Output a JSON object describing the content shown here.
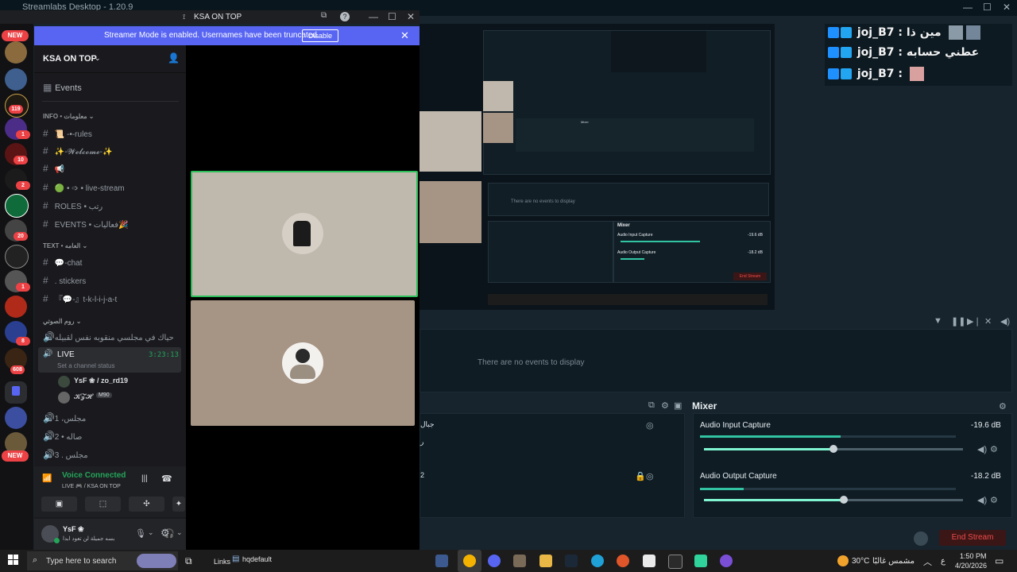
{
  "streamlabs": {
    "window_title": "Streamlabs Desktop - 1.20.9",
    "chat_overlay": [
      {
        "user": "joj_B7",
        "message": "مين ذا"
      },
      {
        "user": "joj_B7",
        "message": "عطني حسابه"
      },
      {
        "user": "joj_B7",
        "message": ""
      }
    ],
    "events_empty": "There are no events to display",
    "mixer_title": "Mixer",
    "mixer": [
      {
        "label": "Audio Input Capture",
        "db": "-19.6 dB",
        "level": 0.55,
        "volume": 0.5
      },
      {
        "label": "Audio Output Capture",
        "db": "-18.2 dB",
        "level": 0.17,
        "volume": 0.54
      }
    ],
    "scene_rows": [
      "جبال",
      "ر",
      "2"
    ],
    "end_stream": "End Stream",
    "preview_labels": {
      "audio_input": "Audio Input Capture",
      "audio_output": "Audio Output Capture",
      "events": "There are no events to display",
      "mixer": "Mixer",
      "db_input": "-19.6 dB",
      "db_output": "-18.2 dB",
      "end_stream": "End Stream"
    }
  },
  "discord": {
    "title": "KSA ON TOP",
    "banner": {
      "text": "Streamer Mode is enabled. Usernames have been truncated.",
      "button": "Disable"
    },
    "server_name": "KSA ON TOP",
    "events_label": "Events",
    "categories": [
      {
        "name": "INFO • معلومات",
        "channels": [
          "📜 -•-rules",
          "✨-𝓦𝓮𝓵𝓬𝓸𝓶𝓮-✨",
          "📢",
          "🟢 • ➩ • live-stream",
          "ROLES • رتب",
          "EVENTS • فعاليات🎉"
        ]
      },
      {
        "name": "TEXT • العامه",
        "channels": [
          "💬-chat",
          ". stickers",
          "『💬-』t-k-l-i-j-a-t"
        ]
      },
      {
        "name": "روم الصوتي",
        "channels": [
          "حياك في مجلسي منقوبه نفس لقبيله"
        ]
      }
    ],
    "live_channel": {
      "name": "LIVE",
      "status": "Set a channel status",
      "timer": "3:23:13"
    },
    "voice_members": [
      {
        "name": "YsF ❀ / zo_rd19"
      },
      {
        "name": "𝓚𝓩𝓗",
        "tag": "M90"
      }
    ],
    "voice_channels": [
      "مجلس، 1",
      "صاله • 2",
      "مجلس . 3"
    ],
    "voice_status": {
      "title": "Voice Connected",
      "detail": "LIVE 🎮 / KSA ON TOP"
    },
    "user": {
      "name": "YsF ❀",
      "status": "بسه جميلة لن تعود ابدا"
    },
    "rail_badges": [
      "119",
      "1",
      "10",
      "2",
      "20",
      "1",
      "8",
      "608",
      "1"
    ],
    "new_label": "NEW"
  },
  "taskbar": {
    "search_placeholder": "Type here to search",
    "links": "Links",
    "folder": "hqdefault",
    "weather": "30°C",
    "weather_text": "مشمس غالبًا",
    "time": "1:50 PM",
    "date": "4/20/2026",
    "lang": "ع"
  }
}
